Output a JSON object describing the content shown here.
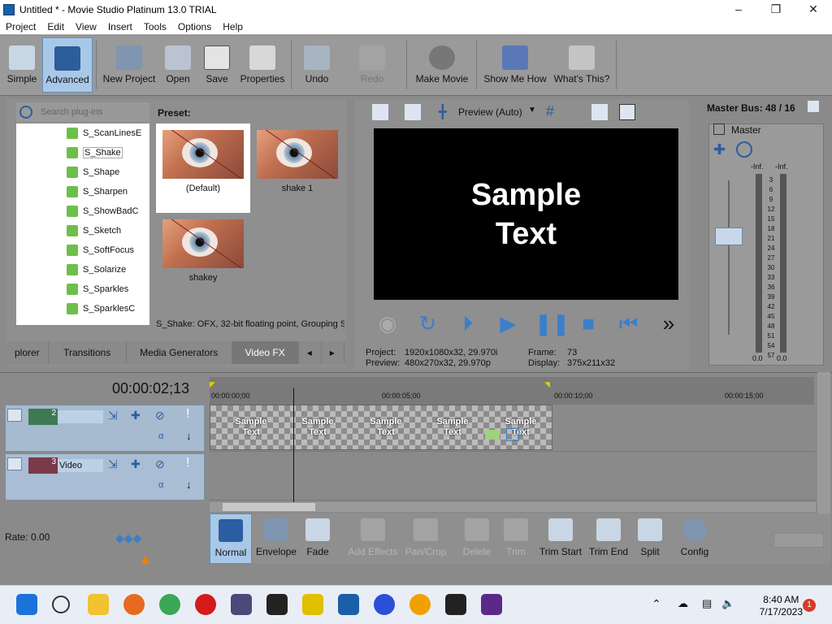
{
  "window": {
    "title": "Untitled * - Movie Studio Platinum 13.0 TRIAL",
    "minimize": "–",
    "maximize": "❐",
    "close": "✕"
  },
  "menu": [
    "Project",
    "Edit",
    "View",
    "Insert",
    "Tools",
    "Options",
    "Help"
  ],
  "toolbar": {
    "simple": "Simple",
    "advanced": "Advanced",
    "new_project": "New Project",
    "open": "Open",
    "save": "Save",
    "properties": "Properties",
    "undo": "Undo",
    "redo": "Redo",
    "make_movie": "Make Movie",
    "show_me_how": "Show Me How",
    "whats_this": "What's This?"
  },
  "plugins": {
    "search_placeholder": "Search plug-ins",
    "items": [
      "S_ScanLinesE",
      "S_Shake",
      "S_Shape",
      "S_Sharpen",
      "S_ShowBadC",
      "S_Sketch",
      "S_SoftFocus",
      "S_Solarize",
      "S_Sparkles",
      "S_SparklesC"
    ],
    "selected": "S_Shake",
    "preset_label": "Preset:",
    "presets": [
      "(Default)",
      "shake 1",
      "shakey"
    ],
    "status": "S_Shake: OFX, 32-bit floating point, Grouping S"
  },
  "dock_tabs": [
    "plorer",
    "Transitions",
    "Media Generators",
    "Video FX"
  ],
  "preview": {
    "mode": "Preview (Auto)",
    "text_line1": "Sample",
    "text_line2": "Text",
    "project_label": "Project:",
    "project_value": "1920x1080x32, 29.970i",
    "preview_label": "Preview:",
    "preview_value": "480x270x32, 29.970p",
    "frame_label": "Frame:",
    "frame_value": "73",
    "display_label": "Display:",
    "display_value": "375x211x32"
  },
  "mixer": {
    "title": "Master Bus: 48 / 16",
    "master": "Master",
    "inf_left": "-Inf.",
    "inf_right": "-Inf.",
    "scale": [
      "3",
      "6",
      "9",
      "12",
      "15",
      "18",
      "21",
      "24",
      "27",
      "30",
      "33",
      "36",
      "39",
      "42",
      "45",
      "48",
      "51",
      "54",
      "57"
    ],
    "bottom_left": "0.0",
    "bottom_right": "0.0"
  },
  "timeline": {
    "timecode": "00:00:02;13",
    "ruler": [
      "00:00:00;00",
      "00:00:05;00",
      "00:00:10;00",
      "00:00:15;00"
    ],
    "tracks": [
      {
        "num": "2",
        "name": ""
      },
      {
        "num": "3",
        "name": "Video"
      }
    ],
    "clip_frames": [
      "Sample Text",
      "Sample Text",
      "Sample Text",
      "Sample Text",
      "Sample Text"
    ]
  },
  "edit_tools": [
    "Normal",
    "Envelope",
    "Fade",
    "Add Effects",
    "Pan/Crop",
    "Delete",
    "Trim",
    "Trim Start",
    "Trim End",
    "Split",
    "Config"
  ],
  "rate": "Rate: 0.00",
  "taskbar": {
    "time": "8:40 AM",
    "date": "7/17/2023",
    "badge": "1"
  }
}
